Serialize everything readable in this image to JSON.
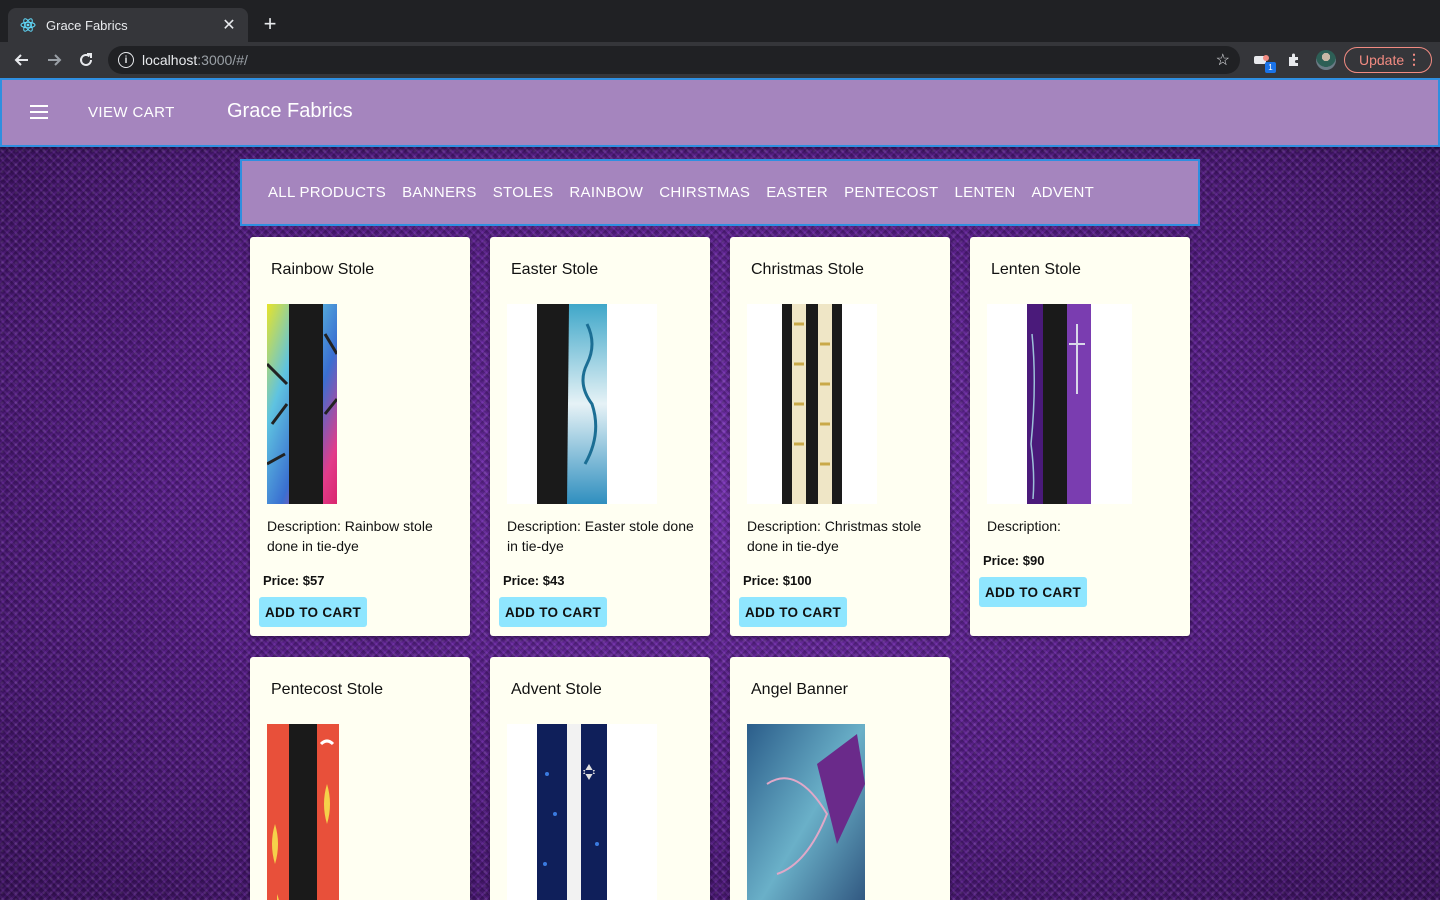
{
  "browser": {
    "tab_title": "Grace Fabrics",
    "url_host": "localhost",
    "url_path": ":3000/#/",
    "extension_badge": "1",
    "update_label": "Update"
  },
  "app": {
    "menu_icon": "hamburger-menu-icon",
    "view_cart_label": "VIEW CART",
    "title": "Grace Fabrics"
  },
  "categories": [
    "ALL PRODUCTS",
    "BANNERS",
    "STOLES",
    "RAINBOW",
    "CHIRSTMAS",
    "EASTER",
    "PENTECOST",
    "LENTEN",
    "ADVENT"
  ],
  "products": [
    {
      "name": "Rainbow Stole",
      "description": "Description: Rainbow stole done in tie-dye",
      "price": "Price: $57",
      "button": "ADD TO CART"
    },
    {
      "name": "Easter Stole",
      "description": "Description: Easter stole done in tie-dye",
      "price": "Price: $43",
      "button": "ADD TO CART"
    },
    {
      "name": "Christmas Stole",
      "description": "Description: Christmas stole done in tie-dye",
      "price": "Price: $100",
      "button": "ADD TO CART"
    },
    {
      "name": "Lenten Stole",
      "description": "Description:",
      "price": "Price: $90",
      "button": "ADD TO CART"
    },
    {
      "name": "Pentecost Stole"
    },
    {
      "name": "Advent Stole"
    },
    {
      "name": "Angel Banner"
    }
  ],
  "colors": {
    "appbar": "#a585be",
    "appbar_border": "#2f8fe0",
    "card_bg": "#fffff2",
    "button_bg": "#8fe6ff"
  }
}
